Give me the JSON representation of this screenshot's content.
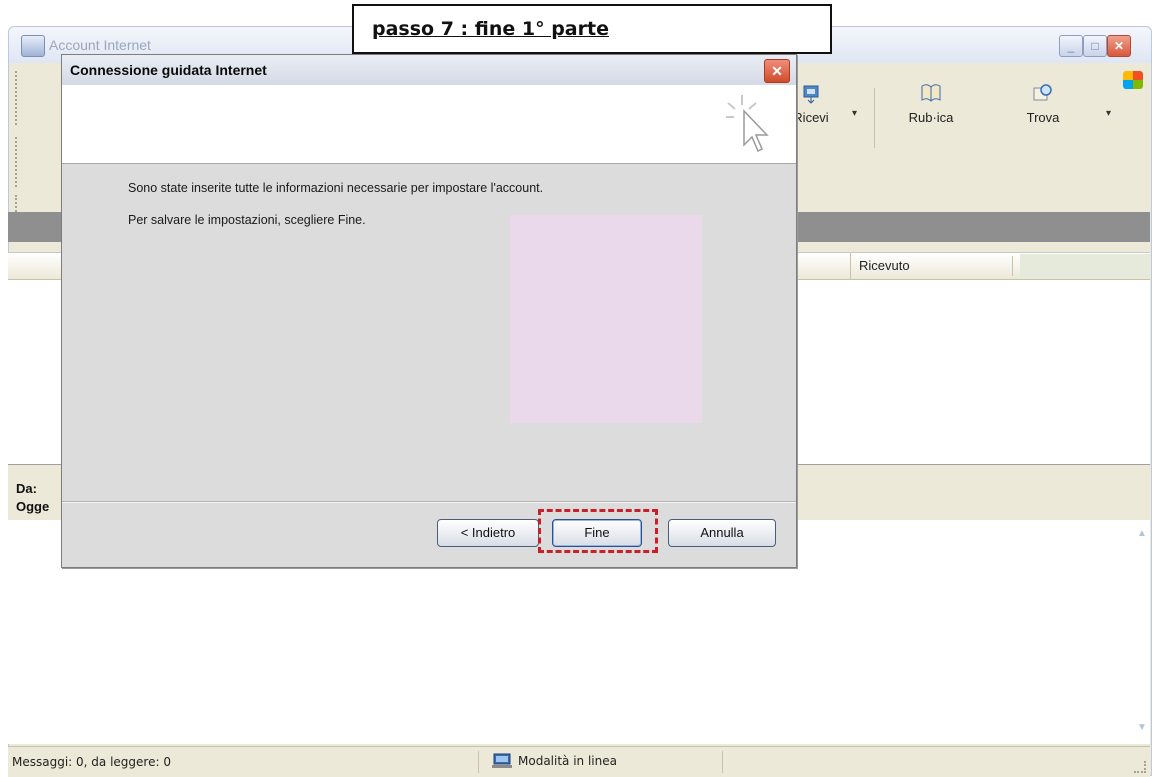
{
  "annotation": {
    "text": "passo 7 : fine 1° parte"
  },
  "main_window": {
    "title": "Account Internet",
    "buttons": [
      "_",
      "□",
      "✕"
    ]
  },
  "toolbar": {
    "ricevi": "Ricevi",
    "rubrica": "Rub·ica",
    "trova": "Trova"
  },
  "message_list": {
    "columns": {
      "ricevuto": "Ricevuto"
    }
  },
  "preview": {
    "da_label": "Da:",
    "oggetto_label": "Ogge"
  },
  "status_bar": {
    "messages": "Messaggi: 0, da leggere: 0",
    "mode": "Modalità in linea"
  },
  "dialog": {
    "title": "Connessione guidata Internet",
    "close": "✕",
    "line1": "Sono state inserite tutte le informazioni necessarie per impostare l'account.",
    "line2": "Per salvare le impostazioni, scegliere Fine.",
    "back_button": "< Indietro",
    "finish_button": "Fine",
    "cancel_button": "Annulla"
  },
  "colors": {
    "highlight": "#c8202a",
    "pink_block": "#ead9ea",
    "close_red": "#d04b2c"
  }
}
